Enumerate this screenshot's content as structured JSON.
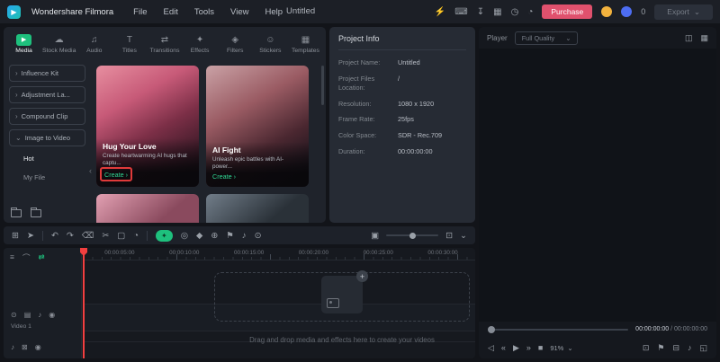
{
  "colors": {
    "accent_green": "#1ec07d",
    "purchase_pink": "#e0516d",
    "annotation_red": "#e03a3a",
    "playhead_red": "#f23f3f"
  },
  "topbar": {
    "app_title": "Wondershare Filmora",
    "menus": {
      "file": "File",
      "edit": "Edit",
      "tools": "Tools",
      "view": "View",
      "help": "Help"
    },
    "document_title": "Untitled",
    "purchase_label": "Purchase",
    "points_count": "0",
    "export_label": "Export"
  },
  "tabs": {
    "media": "Media",
    "stock": "Stock Media",
    "audio": "Audio",
    "titles": "Titles",
    "transitions": "Transitions",
    "effects": "Effects",
    "filters": "Filters",
    "stickers": "Stickers",
    "templates": "Templates"
  },
  "sidebar": {
    "influence": "Influence Kit",
    "adjustment": "Adjustment La...",
    "compound": "Compound Clip",
    "image_to_video": "Image to Video",
    "hot": "Hot",
    "my_file": "My File"
  },
  "cards": {
    "c1": {
      "title": "Hug Your Love",
      "desc": "Create heartwarming AI hugs that captu...",
      "cta": "Create ›"
    },
    "c2": {
      "title": "AI Fight",
      "desc": "Unleash epic battles with AI-power...",
      "cta": "Create ›"
    }
  },
  "project_info": {
    "title": "Project Info",
    "f1": {
      "label": "Project Name:",
      "value": "Untitled"
    },
    "f2": {
      "label": "Project Files Location:",
      "value": "/"
    },
    "f3": {
      "label": "Resolution:",
      "value": "1080 x 1920"
    },
    "f4": {
      "label": "Frame Rate:",
      "value": "25fps"
    },
    "f5": {
      "label": "Color Space:",
      "value": "SDR - Rec.709"
    },
    "f6": {
      "label": "Duration:",
      "value": "00:00:00:00"
    }
  },
  "player": {
    "label": "Player",
    "quality": "Full Quality",
    "timecode_current": "00:00:00:00",
    "timecode_separator": "/",
    "timecode_total": "00:00:00:00",
    "zoom_level": "91%"
  },
  "timeline": {
    "ruler": {
      "t1": "00:00:05:00",
      "t2": "00:00:10:00",
      "t3": "00:00:15:00",
      "t4": "00:00:20:00",
      "t5": "00:00:25:00",
      "t6": "00:00:30:00"
    },
    "video_track_label": "Video 1",
    "drop_hint": "Drag and drop media and effects here to create your videos"
  },
  "icons": {
    "logo": "▶",
    "caret_down": "⌄",
    "chevron_right": "›",
    "chevron_left": "‹",
    "promo": "⚡",
    "keyboard": "⌨",
    "download": "↧",
    "layout": "▦",
    "history": "◷",
    "bell": "◔",
    "tab_media": "▶",
    "tab_stock": "☁",
    "tab_audio": "♫",
    "tab_titles": "T",
    "tab_transitions": "⇄",
    "tab_effects": "✦",
    "tab_filters": "◈",
    "tab_stickers": "☺",
    "tab_templates": "▦",
    "grid": "⊞",
    "cursor": "➤",
    "undo": "↶",
    "redo": "↷",
    "delete": "⌫",
    "split": "✂",
    "crop": "▢",
    "speed": "◔",
    "ai_sparkle": "✦",
    "mask": "◎",
    "keyframe": "◆",
    "chroma": "⊕",
    "marker": "⚑",
    "voiceover": "♪",
    "screen_record": "⊙",
    "render": "▣",
    "fit": "⊡",
    "compare": "◫",
    "grid_view": "▦",
    "volume": "◁",
    "prev_frame": "«",
    "play": "▶",
    "next_frame": "»",
    "stop": "■",
    "snapshot": "⊡",
    "mark": "⚑",
    "display": "⊟",
    "sound": "♪",
    "fullscreen": "◱",
    "tracks": "≡",
    "snap": "⌒",
    "ripple": "⇄",
    "camera": "⊙",
    "folder": "▤",
    "mute": "♪",
    "eye": "◉",
    "lock": "⊠",
    "plus": "+"
  }
}
